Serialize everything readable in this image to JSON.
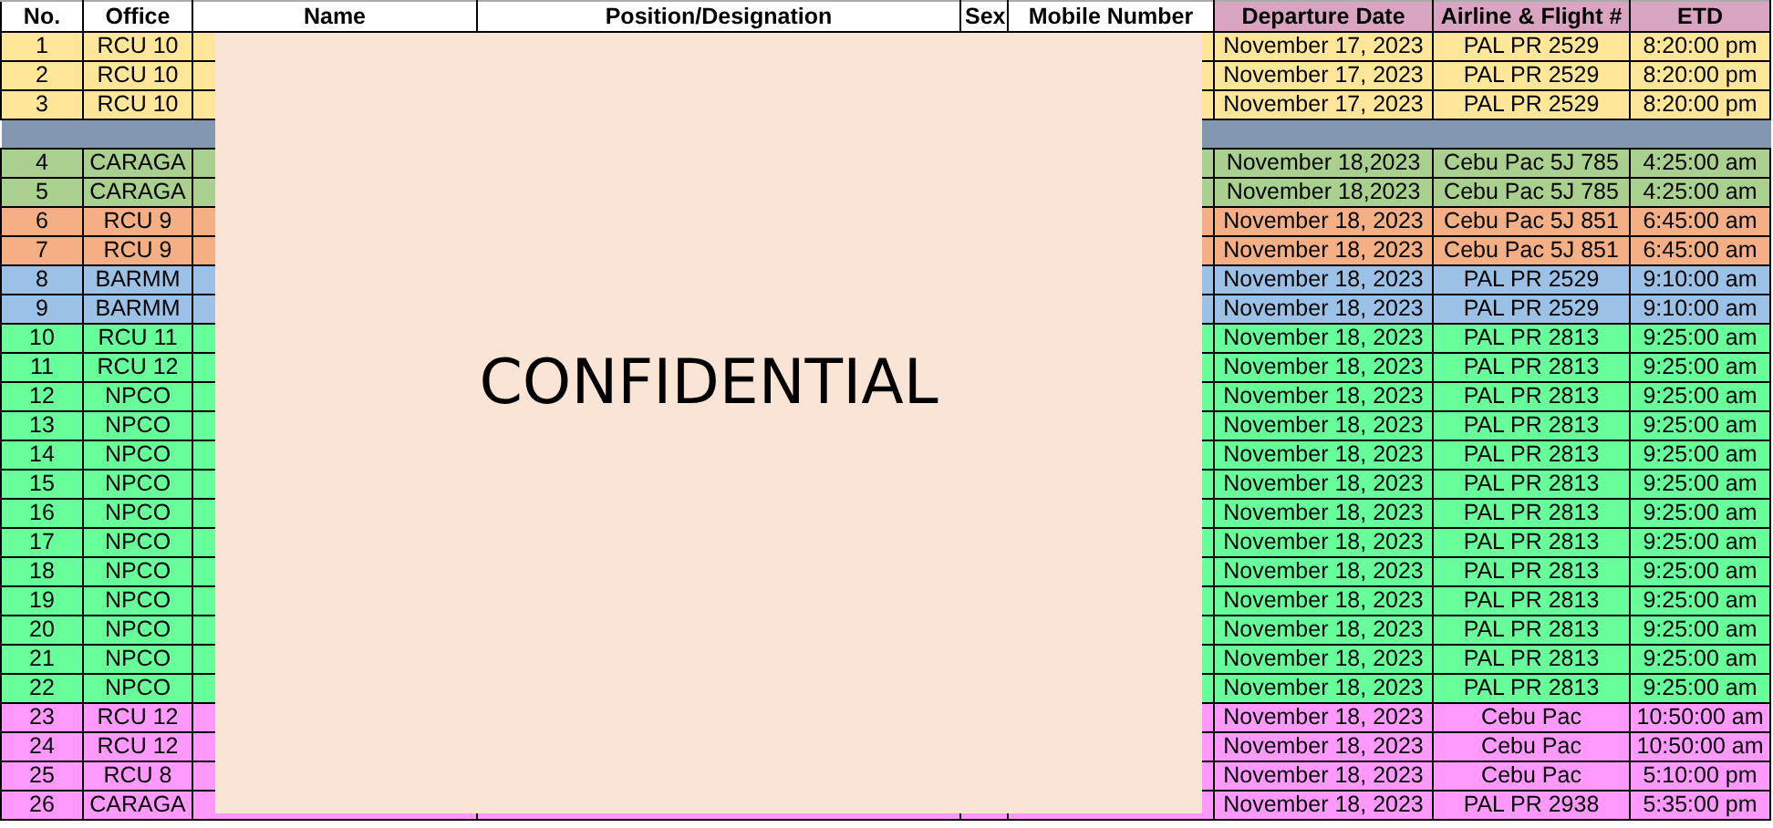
{
  "columns": [
    {
      "label": "No.",
      "color": "#ffffff"
    },
    {
      "label": "Office",
      "color": "#ffffff"
    },
    {
      "label": "Name",
      "color": "#ffffff"
    },
    {
      "label": "Position/Designation",
      "color": "#ffffff"
    },
    {
      "label": "Sex",
      "color": "#ffffff"
    },
    {
      "label": "Mobile Number",
      "color": "#ffffff"
    },
    {
      "label": "Departure Date",
      "color": "#d9a3c2"
    },
    {
      "label": "Airline & Flight #",
      "color": "#d9a3c2"
    },
    {
      "label": "ETD",
      "color": "#d9a3c2"
    }
  ],
  "rows": [
    {
      "kind": "entry",
      "no": "1",
      "office": "RCU 10",
      "departure_date": "November 17, 2023",
      "airline_flight": "PAL PR 2529",
      "etd": "8:20:00 pm",
      "color": "#ffe699"
    },
    {
      "kind": "entry",
      "no": "2",
      "office": "RCU 10",
      "departure_date": "November 17, 2023",
      "airline_flight": "PAL PR 2529",
      "etd": "8:20:00 pm",
      "color": "#ffe699"
    },
    {
      "kind": "entry",
      "no": "3",
      "office": "RCU 10",
      "departure_date": "November 17, 2023",
      "airline_flight": "PAL PR 2529",
      "etd": "8:20:00 pm",
      "color": "#ffe699"
    },
    {
      "kind": "separator",
      "color": "#8497b0"
    },
    {
      "kind": "entry",
      "no": "4",
      "office": "CARAGA",
      "departure_date": "November 18,2023",
      "airline_flight": "Cebu Pac 5J 785",
      "etd": "4:25:00 am",
      "color": "#a9d08e"
    },
    {
      "kind": "entry",
      "no": "5",
      "office": "CARAGA",
      "departure_date": "November 18,2023",
      "airline_flight": "Cebu Pac 5J 785",
      "etd": "4:25:00 am",
      "color": "#a9d08e"
    },
    {
      "kind": "entry",
      "no": "6",
      "office": "RCU 9",
      "departure_date": "November 18, 2023",
      "airline_flight": "Cebu Pac 5J 851",
      "etd": "6:45:00 am",
      "color": "#f4b084"
    },
    {
      "kind": "entry",
      "no": "7",
      "office": "RCU 9",
      "departure_date": "November 18, 2023",
      "airline_flight": "Cebu Pac 5J 851",
      "etd": "6:45:00 am",
      "color": "#f4b084"
    },
    {
      "kind": "entry",
      "no": "8",
      "office": "BARMM",
      "departure_date": "November 18, 2023",
      "airline_flight": "PAL PR 2529",
      "etd": "9:10:00 am",
      "color": "#9bc2e6"
    },
    {
      "kind": "entry",
      "no": "9",
      "office": "BARMM",
      "departure_date": "November 18, 2023",
      "airline_flight": "PAL PR 2529",
      "etd": "9:10:00 am",
      "color": "#9bc2e6"
    },
    {
      "kind": "entry",
      "no": "10",
      "office": "RCU 11",
      "departure_date": "November 18, 2023",
      "airline_flight": "PAL PR 2813",
      "etd": "9:25:00 am",
      "color": "#66ff99"
    },
    {
      "kind": "entry",
      "no": "11",
      "office": "RCU 12",
      "departure_date": "November 18, 2023",
      "airline_flight": "PAL PR 2813",
      "etd": "9:25:00 am",
      "color": "#66ff99"
    },
    {
      "kind": "entry",
      "no": "12",
      "office": "NPCO",
      "departure_date": "November 18, 2023",
      "airline_flight": "PAL PR 2813",
      "etd": "9:25:00 am",
      "color": "#66ff99"
    },
    {
      "kind": "entry",
      "no": "13",
      "office": "NPCO",
      "departure_date": "November 18, 2023",
      "airline_flight": "PAL PR 2813",
      "etd": "9:25:00 am",
      "color": "#66ff99"
    },
    {
      "kind": "entry",
      "no": "14",
      "office": "NPCO",
      "departure_date": "November 18, 2023",
      "airline_flight": "PAL PR 2813",
      "etd": "9:25:00 am",
      "color": "#66ff99"
    },
    {
      "kind": "entry",
      "no": "15",
      "office": "NPCO",
      "departure_date": "November 18, 2023",
      "airline_flight": "PAL PR 2813",
      "etd": "9:25:00 am",
      "color": "#66ff99"
    },
    {
      "kind": "entry",
      "no": "16",
      "office": "NPCO",
      "departure_date": "November 18, 2023",
      "airline_flight": "PAL PR 2813",
      "etd": "9:25:00 am",
      "color": "#66ff99"
    },
    {
      "kind": "entry",
      "no": "17",
      "office": "NPCO",
      "departure_date": "November 18, 2023",
      "airline_flight": "PAL PR 2813",
      "etd": "9:25:00 am",
      "color": "#66ff99"
    },
    {
      "kind": "entry",
      "no": "18",
      "office": "NPCO",
      "departure_date": "November 18, 2023",
      "airline_flight": "PAL PR 2813",
      "etd": "9:25:00 am",
      "color": "#66ff99"
    },
    {
      "kind": "entry",
      "no": "19",
      "office": "NPCO",
      "departure_date": "November 18, 2023",
      "airline_flight": "PAL PR 2813",
      "etd": "9:25:00 am",
      "color": "#66ff99"
    },
    {
      "kind": "entry",
      "no": "20",
      "office": "NPCO",
      "departure_date": "November 18, 2023",
      "airline_flight": "PAL PR 2813",
      "etd": "9:25:00 am",
      "color": "#66ff99"
    },
    {
      "kind": "entry",
      "no": "21",
      "office": "NPCO",
      "departure_date": "November 18, 2023",
      "airline_flight": "PAL PR 2813",
      "etd": "9:25:00 am",
      "color": "#66ff99"
    },
    {
      "kind": "entry",
      "no": "22",
      "office": "NPCO",
      "departure_date": "November 18, 2023",
      "airline_flight": "PAL PR 2813",
      "etd": "9:25:00 am",
      "color": "#66ff99"
    },
    {
      "kind": "entry",
      "no": "23",
      "office": "RCU 12",
      "departure_date": "November 18, 2023",
      "airline_flight": "Cebu Pac",
      "etd": "10:50:00 am",
      "color": "#ff99ff"
    },
    {
      "kind": "entry",
      "no": "24",
      "office": "RCU 12",
      "departure_date": "November 18, 2023",
      "airline_flight": "Cebu Pac",
      "etd": "10:50:00 am",
      "color": "#ff99ff"
    },
    {
      "kind": "entry",
      "no": "25",
      "office": "RCU 8",
      "departure_date": "November 18, 2023",
      "airline_flight": "Cebu Pac",
      "etd": "5:10:00 pm",
      "color": "#ff99ff"
    },
    {
      "kind": "entry",
      "no": "26",
      "office": "CARAGA",
      "departure_date": "November 18, 2023",
      "airline_flight": "PAL PR 2938",
      "etd": "5:35:00 pm",
      "color": "#ff99ff"
    }
  ],
  "overlay": {
    "label": "CONFIDENTIAL"
  }
}
